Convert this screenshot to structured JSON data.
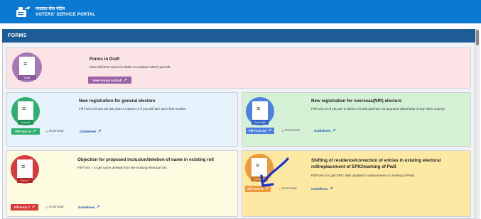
{
  "header": {
    "title_hi": "मतदाता सेवा पोर्टल",
    "title_en": "VOTERS' SERVICE PORTAL"
  },
  "section": {
    "title": "FORMS"
  },
  "draft": {
    "title": "Forms in Draft",
    "desc": "View all forms saved in drafts to continue where you left.",
    "button": "View Forms in Draft",
    "tag": "Draft",
    "color": "#a778b6"
  },
  "cards": [
    {
      "title": "New registration for general electors",
      "desc": "Fill Form 6 if you are 18 years or above or if you will turn 18 in few months",
      "button": "Fill Form 6",
      "download": "Download",
      "guidelines": "Guidelines",
      "tag": "Form 6",
      "color": "#2eb06e"
    },
    {
      "title": "New registration for overseas(NRI) electors",
      "desc": "Fill Form 6A if you are a citizen of India and has not acquired citizenship of any other country.",
      "button": "Fill Form 6A",
      "download": "Download",
      "guidelines": "Guidelines",
      "tag": "Form 6A",
      "color": "#4f7fe0"
    },
    {
      "title": "Objection for proposed inclusion/deletion of name in existing roll",
      "desc": "Fill Form 7 to get name deleted from the existing electoral roll.",
      "button": "Fill Form 7",
      "download": "Download",
      "guidelines": "Guidelines",
      "tag": "Form 7",
      "color": "#d8393a"
    },
    {
      "title_line1": "Shifting of residence/correction of entries in existing electoral",
      "title_line2": "roll/replacement of EPIC/marking of PwD",
      "desc": "Fill Form 8 to get EPIC with updated or replacement or marking of PwD.",
      "button": "Fill Form 8",
      "download": "Download",
      "guidelines": "Guidelines",
      "tag": "Form 8",
      "color": "#ec9a3a"
    }
  ],
  "colors": {
    "topbar": "#0b79d0",
    "header": "#1f5c95",
    "draft_bg": "#fbe3e6",
    "form6_bg": "#e5f2fb",
    "form6a_bg": "#d5f1d5",
    "form7_bg": "#fdfbe0",
    "form8_bg": "#fde9a4",
    "annotation": "#1530d6"
  },
  "icons": {
    "doc": "document-icon",
    "download": "download-icon",
    "external": "external-link-icon",
    "annotation": "arrow-annotation"
  }
}
